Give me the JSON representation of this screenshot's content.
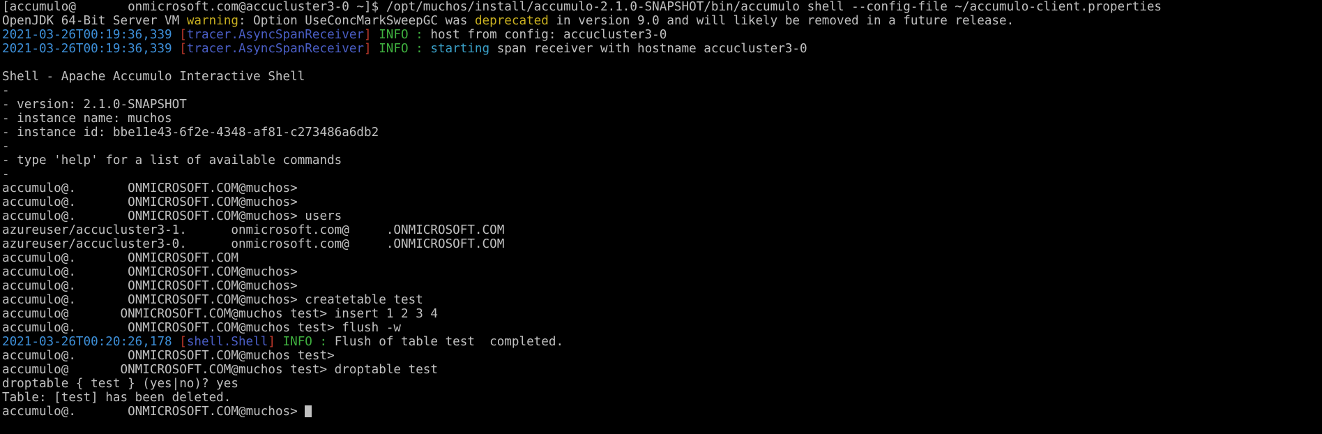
{
  "lines": [
    {
      "parts": [
        {
          "t": "[accumulo@",
          "c": ""
        },
        {
          "t": "       ",
          "c": "redact"
        },
        {
          "t": "onmicrosoft.com@accucluster3-0 ~]$ /opt/muchos/install/accumulo-2.1.0-SNAPSHOT/bin/accumulo shell --config-file ~/accumulo-client.properties",
          "c": ""
        }
      ]
    },
    {
      "parts": [
        {
          "t": "OpenJDK 64-Bit Server VM ",
          "c": ""
        },
        {
          "t": "warning",
          "c": "warn"
        },
        {
          "t": ": Option UseConcMarkSweepGC was ",
          "c": ""
        },
        {
          "t": "deprecated",
          "c": "dep"
        },
        {
          "t": " in version 9.0 and will likely be removed in a future release.",
          "c": ""
        }
      ]
    },
    {
      "parts": [
        {
          "t": "2021-03-26T00:19:36,339 ",
          "c": "ts"
        },
        {
          "t": "[",
          "c": "br"
        },
        {
          "t": "tracer.AsyncSpanReceiver",
          "c": "cls"
        },
        {
          "t": "] ",
          "c": "br"
        },
        {
          "t": "INFO",
          "c": "info"
        },
        {
          "t": " : ",
          "c": "colon"
        },
        {
          "t": "host from config: accucluster3-0",
          "c": ""
        }
      ]
    },
    {
      "parts": [
        {
          "t": "2021-03-26T00:19:36,339 ",
          "c": "ts"
        },
        {
          "t": "[",
          "c": "br"
        },
        {
          "t": "tracer.AsyncSpanReceiver",
          "c": "cls"
        },
        {
          "t": "] ",
          "c": "br"
        },
        {
          "t": "INFO",
          "c": "info"
        },
        {
          "t": " : ",
          "c": "colon"
        },
        {
          "t": "starting",
          "c": "starting"
        },
        {
          "t": " span receiver with hostname accucluster3-0",
          "c": ""
        }
      ]
    },
    {
      "parts": [
        {
          "t": "",
          "c": ""
        }
      ]
    },
    {
      "parts": [
        {
          "t": "Shell - Apache Accumulo Interactive Shell",
          "c": ""
        }
      ]
    },
    {
      "parts": [
        {
          "t": "-",
          "c": ""
        }
      ]
    },
    {
      "parts": [
        {
          "t": "- version: 2.1.0-SNAPSHOT",
          "c": ""
        }
      ]
    },
    {
      "parts": [
        {
          "t": "- instance name: muchos",
          "c": ""
        }
      ]
    },
    {
      "parts": [
        {
          "t": "- instance id: bbe11e43-6f2e-4348-af81-c273486a6db2",
          "c": ""
        }
      ]
    },
    {
      "parts": [
        {
          "t": "-",
          "c": ""
        }
      ]
    },
    {
      "parts": [
        {
          "t": "- type 'help' for a list of available commands",
          "c": ""
        }
      ]
    },
    {
      "parts": [
        {
          "t": "-",
          "c": ""
        }
      ]
    },
    {
      "parts": [
        {
          "t": "accumulo@.",
          "c": ""
        },
        {
          "t": "       ",
          "c": "redact"
        },
        {
          "t": "ONMICROSOFT.COM@muchos>",
          "c": ""
        }
      ]
    },
    {
      "parts": [
        {
          "t": "accumulo@.",
          "c": ""
        },
        {
          "t": "       ",
          "c": "redact"
        },
        {
          "t": "ONMICROSOFT.COM@muchos>",
          "c": ""
        }
      ]
    },
    {
      "parts": [
        {
          "t": "accumulo@.",
          "c": ""
        },
        {
          "t": "       ",
          "c": "redact"
        },
        {
          "t": "ONMICROSOFT.COM@muchos> users",
          "c": ""
        }
      ]
    },
    {
      "parts": [
        {
          "t": "azureuser/accucluster3-1.",
          "c": ""
        },
        {
          "t": "      ",
          "c": "redact"
        },
        {
          "t": "onmicrosoft.com@",
          "c": ""
        },
        {
          "t": "     ",
          "c": "redact"
        },
        {
          "t": ".ONMICROSOFT.COM",
          "c": ""
        }
      ]
    },
    {
      "parts": [
        {
          "t": "azureuser/accucluster3-0.",
          "c": ""
        },
        {
          "t": "      ",
          "c": "redact"
        },
        {
          "t": "onmicrosoft.com@",
          "c": ""
        },
        {
          "t": "     ",
          "c": "redact"
        },
        {
          "t": ".ONMICROSOFT.COM",
          "c": ""
        }
      ]
    },
    {
      "parts": [
        {
          "t": "accumulo@.",
          "c": ""
        },
        {
          "t": "       ",
          "c": "redact"
        },
        {
          "t": "ONMICROSOFT.COM",
          "c": ""
        }
      ]
    },
    {
      "parts": [
        {
          "t": "accumulo@.",
          "c": ""
        },
        {
          "t": "       ",
          "c": "redact"
        },
        {
          "t": "ONMICROSOFT.COM@muchos>",
          "c": ""
        }
      ]
    },
    {
      "parts": [
        {
          "t": "accumulo@.",
          "c": ""
        },
        {
          "t": "       ",
          "c": "redact"
        },
        {
          "t": "ONMICROSOFT.COM@muchos>",
          "c": ""
        }
      ]
    },
    {
      "parts": [
        {
          "t": "accumulo@.",
          "c": ""
        },
        {
          "t": "       ",
          "c": "redact"
        },
        {
          "t": "ONMICROSOFT.COM@muchos> createtable test",
          "c": ""
        }
      ]
    },
    {
      "parts": [
        {
          "t": "accumulo@",
          "c": ""
        },
        {
          "t": "       ",
          "c": "redact"
        },
        {
          "t": "ONMICROSOFT.COM@muchos test> insert 1 2 3 4",
          "c": ""
        }
      ]
    },
    {
      "parts": [
        {
          "t": "accumulo@.",
          "c": ""
        },
        {
          "t": "       ",
          "c": "redact"
        },
        {
          "t": "ONMICROSOFT.COM@muchos test> flush -w",
          "c": ""
        }
      ]
    },
    {
      "parts": [
        {
          "t": "2021-03-26T00:20:26,178 ",
          "c": "ts"
        },
        {
          "t": "[",
          "c": "br"
        },
        {
          "t": "shell.Shell",
          "c": "cls"
        },
        {
          "t": "] ",
          "c": "br"
        },
        {
          "t": "INFO",
          "c": "info"
        },
        {
          "t": " : ",
          "c": "colon"
        },
        {
          "t": "Flush of table test  completed.",
          "c": "flush"
        }
      ]
    },
    {
      "parts": [
        {
          "t": "accumulo@.",
          "c": ""
        },
        {
          "t": "       ",
          "c": "redact"
        },
        {
          "t": "ONMICROSOFT.COM@muchos test>",
          "c": ""
        }
      ]
    },
    {
      "parts": [
        {
          "t": "accumulo@",
          "c": ""
        },
        {
          "t": "       ",
          "c": "redact"
        },
        {
          "t": "ONMICROSOFT.COM@muchos test> droptable test",
          "c": ""
        }
      ]
    },
    {
      "parts": [
        {
          "t": "droptable { test } (yes|no)? yes",
          "c": ""
        }
      ]
    },
    {
      "parts": [
        {
          "t": "Table: [test] has been deleted.",
          "c": ""
        }
      ]
    },
    {
      "parts": [
        {
          "t": "accumulo@.",
          "c": ""
        },
        {
          "t": "       ",
          "c": "redact"
        },
        {
          "t": "ONMICROSOFT.COM@muchos> ",
          "c": ""
        }
      ],
      "cursor": true
    }
  ],
  "colors": {
    "background": "#000000",
    "foreground": "#c0c0c0",
    "timestamp": "#3d8fd8",
    "bracket": "#c0392b",
    "class": "#4a5ec6",
    "info": "#3fb03f",
    "warning": "#c9b020"
  }
}
